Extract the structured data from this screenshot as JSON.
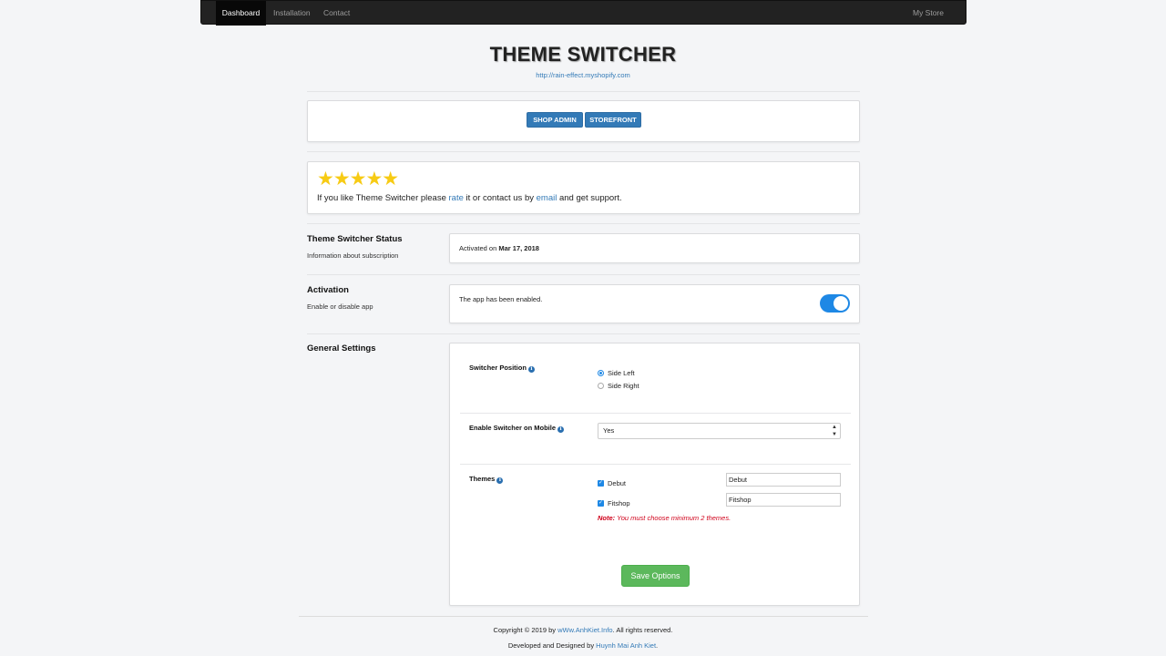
{
  "nav": {
    "items": [
      "Dashboard",
      "Installation",
      "Contact"
    ],
    "right": "My Store"
  },
  "header": {
    "title": "THEME SWITCHER",
    "store_url": "http://rain-effect.myshopify.com"
  },
  "buttons": {
    "shop_admin": "SHOP ADMIN",
    "storefront": "STOREFRONT"
  },
  "rating": {
    "stars": "★★★★★",
    "rating_value": 5,
    "text_before": "If you like Theme Switcher please ",
    "rate_link": "rate",
    "text_middle": " it or contact us by ",
    "email_link": "email",
    "text_after": " and get support."
  },
  "status": {
    "title": "Theme Switcher Status",
    "subtitle": "Information about subscription",
    "activated_prefix": "Activated on ",
    "activated_date": "Mar 17, 2018"
  },
  "activation": {
    "title": "Activation",
    "subtitle": "Enable or disable app",
    "message": "The app has been enabled.",
    "enabled": true
  },
  "general": {
    "title": "General Settings",
    "position_label": "Switcher Position",
    "position_options": [
      "Side Left",
      "Side Right"
    ],
    "position_selected": "Side Left",
    "mobile_label": "Enable Switcher on Mobile",
    "mobile_value": "Yes",
    "themes_label": "Themes",
    "themes": [
      {
        "name": "Debut",
        "checked": true,
        "value": "Debut"
      },
      {
        "name": "Fitshop",
        "checked": true,
        "value": "Fitshop"
      }
    ],
    "note_label": "Note:",
    "note_text": " You must choose minimum 2 themes.",
    "save_label": "Save Options"
  },
  "footer": {
    "copyright_prefix": "Copyright © 2019 by ",
    "copyright_link": "wWw.AnhKiet.Info",
    "copyright_suffix": ". All rights reserved.",
    "developed_prefix": "Developed and Designed by ",
    "developed_link": "Huynh Mai Anh Kiet",
    "developed_suffix": "."
  },
  "icons": {
    "info": "info-icon",
    "star": "star-icon",
    "check": "checkmark-icon",
    "caret": "caret-updown-icon"
  },
  "colors": {
    "primary": "#337ab7",
    "success": "#5cb85c",
    "toggle": "#1e88e5",
    "note": "#d0021b",
    "star": "#f7cb14",
    "navbar": "#222222"
  }
}
